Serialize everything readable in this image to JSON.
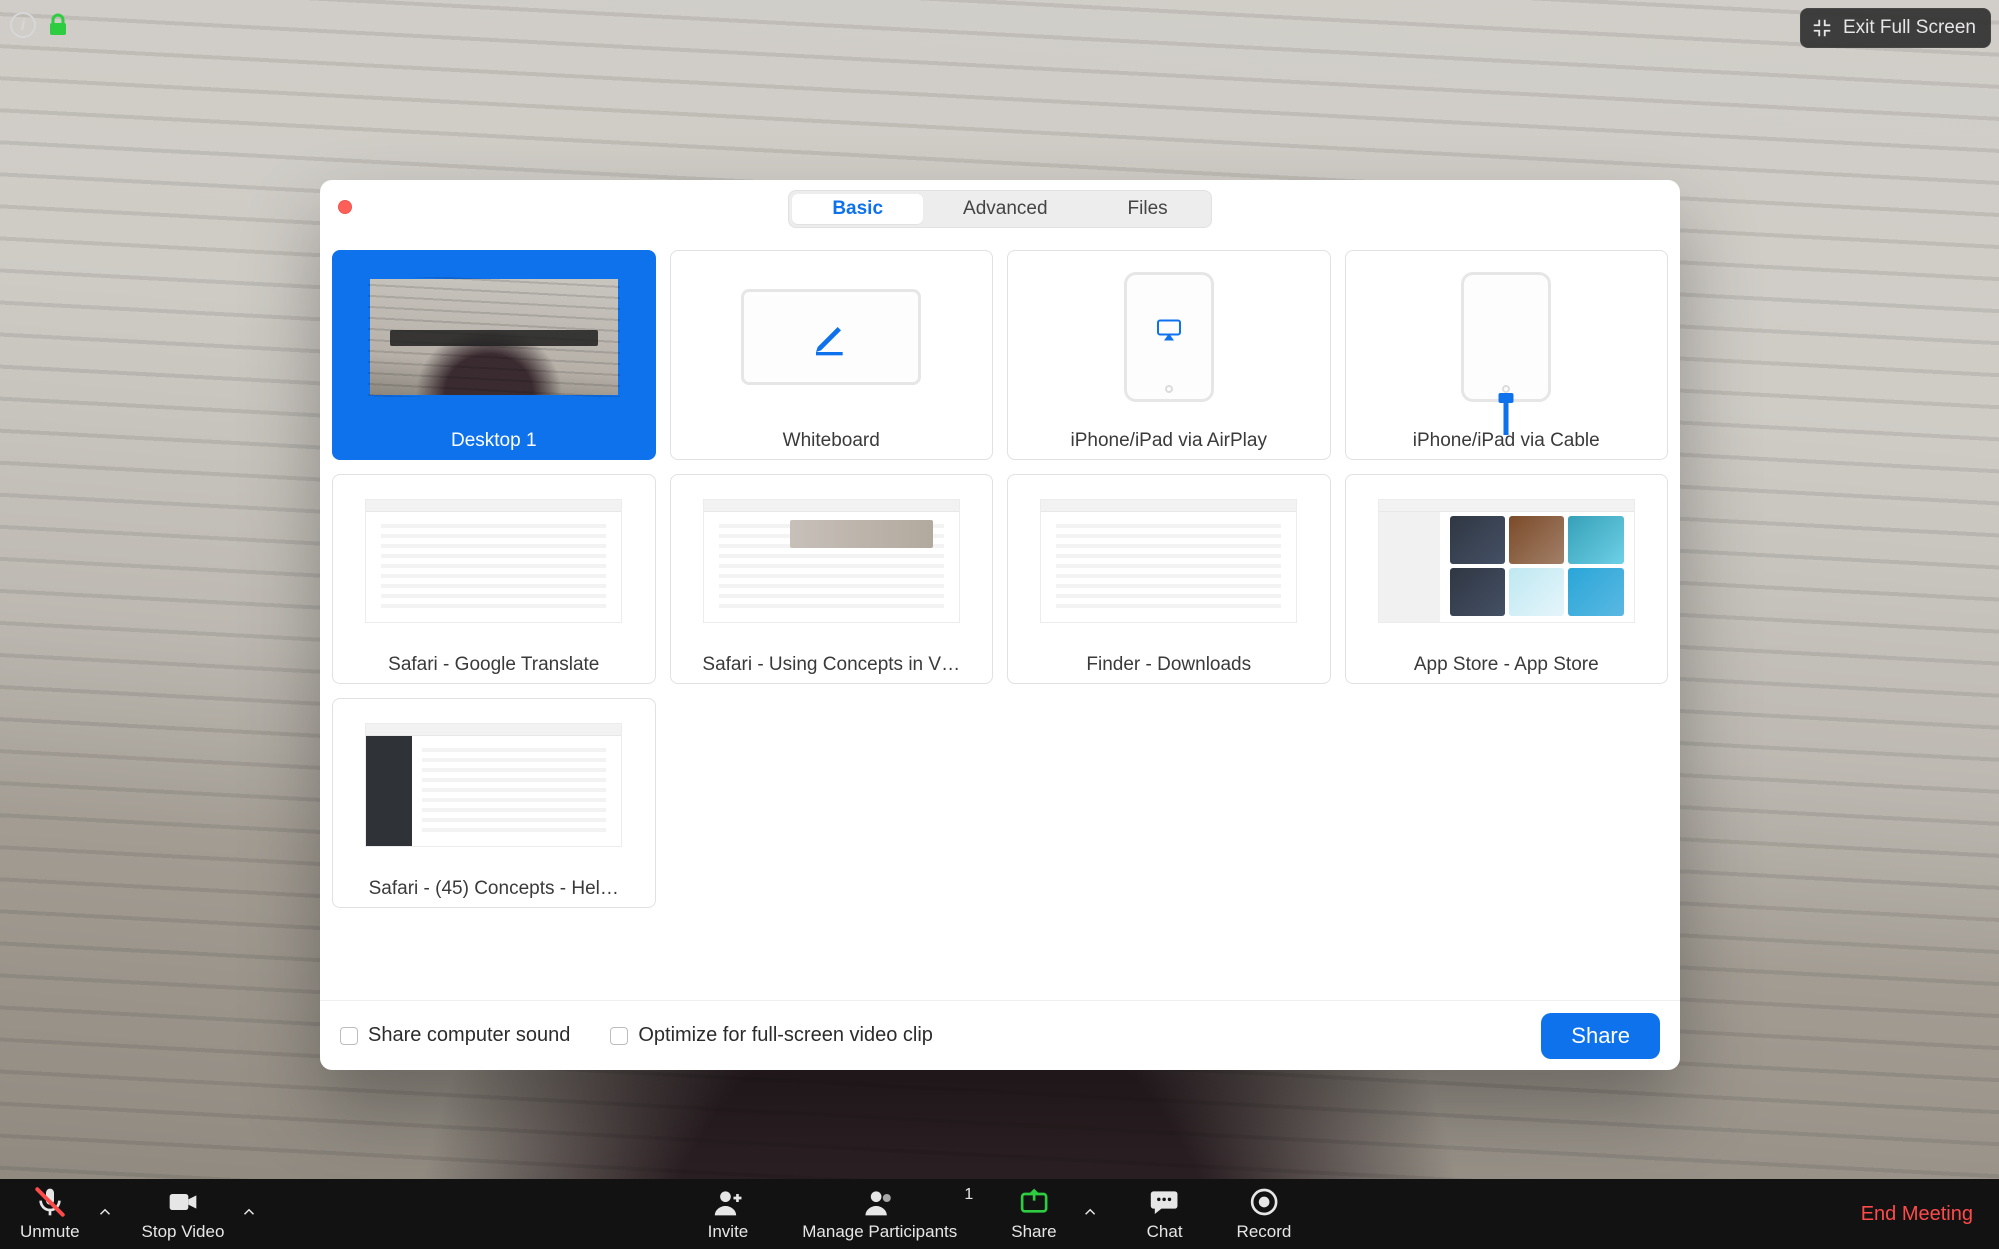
{
  "top": {
    "exit_full_screen": "Exit Full Screen"
  },
  "share_dialog": {
    "tabs": {
      "basic": "Basic",
      "advanced": "Advanced",
      "files": "Files",
      "active": "basic"
    },
    "tiles": [
      {
        "id": "desktop1",
        "label": "Desktop 1",
        "kind": "desktop",
        "selected": true
      },
      {
        "id": "whiteboard",
        "label": "Whiteboard",
        "kind": "whiteboard",
        "selected": false
      },
      {
        "id": "airplay",
        "label": "iPhone/iPad via AirPlay",
        "kind": "phone_airplay",
        "selected": false
      },
      {
        "id": "cable",
        "label": "iPhone/iPad via Cable",
        "kind": "phone_cable",
        "selected": false
      },
      {
        "id": "safari1",
        "label": "Safari - Google Translate",
        "kind": "app",
        "selected": false
      },
      {
        "id": "safari2",
        "label": "Safari - Using Concepts in V…",
        "kind": "app_pic",
        "selected": false
      },
      {
        "id": "finder",
        "label": "Finder - Downloads",
        "kind": "app",
        "selected": false
      },
      {
        "id": "appstore",
        "label": "App Store - App Store",
        "kind": "appstore",
        "selected": false
      },
      {
        "id": "safari3",
        "label": "Safari - (45) Concepts - Hel…",
        "kind": "app_sidebar",
        "selected": false
      }
    ],
    "share_computer_sound": "Share computer sound",
    "optimize_video": "Optimize for full-screen video clip",
    "share_button": "Share"
  },
  "toolbar": {
    "unmute": "Unmute",
    "stop_video": "Stop Video",
    "invite": "Invite",
    "manage_participants": "Manage Participants",
    "participant_count": "1",
    "share": "Share",
    "chat": "Chat",
    "record": "Record",
    "end_meeting": "End Meeting"
  },
  "colors": {
    "accent": "#0e72ed",
    "danger": "#ff4a4a",
    "share_green": "#2ecc40"
  }
}
